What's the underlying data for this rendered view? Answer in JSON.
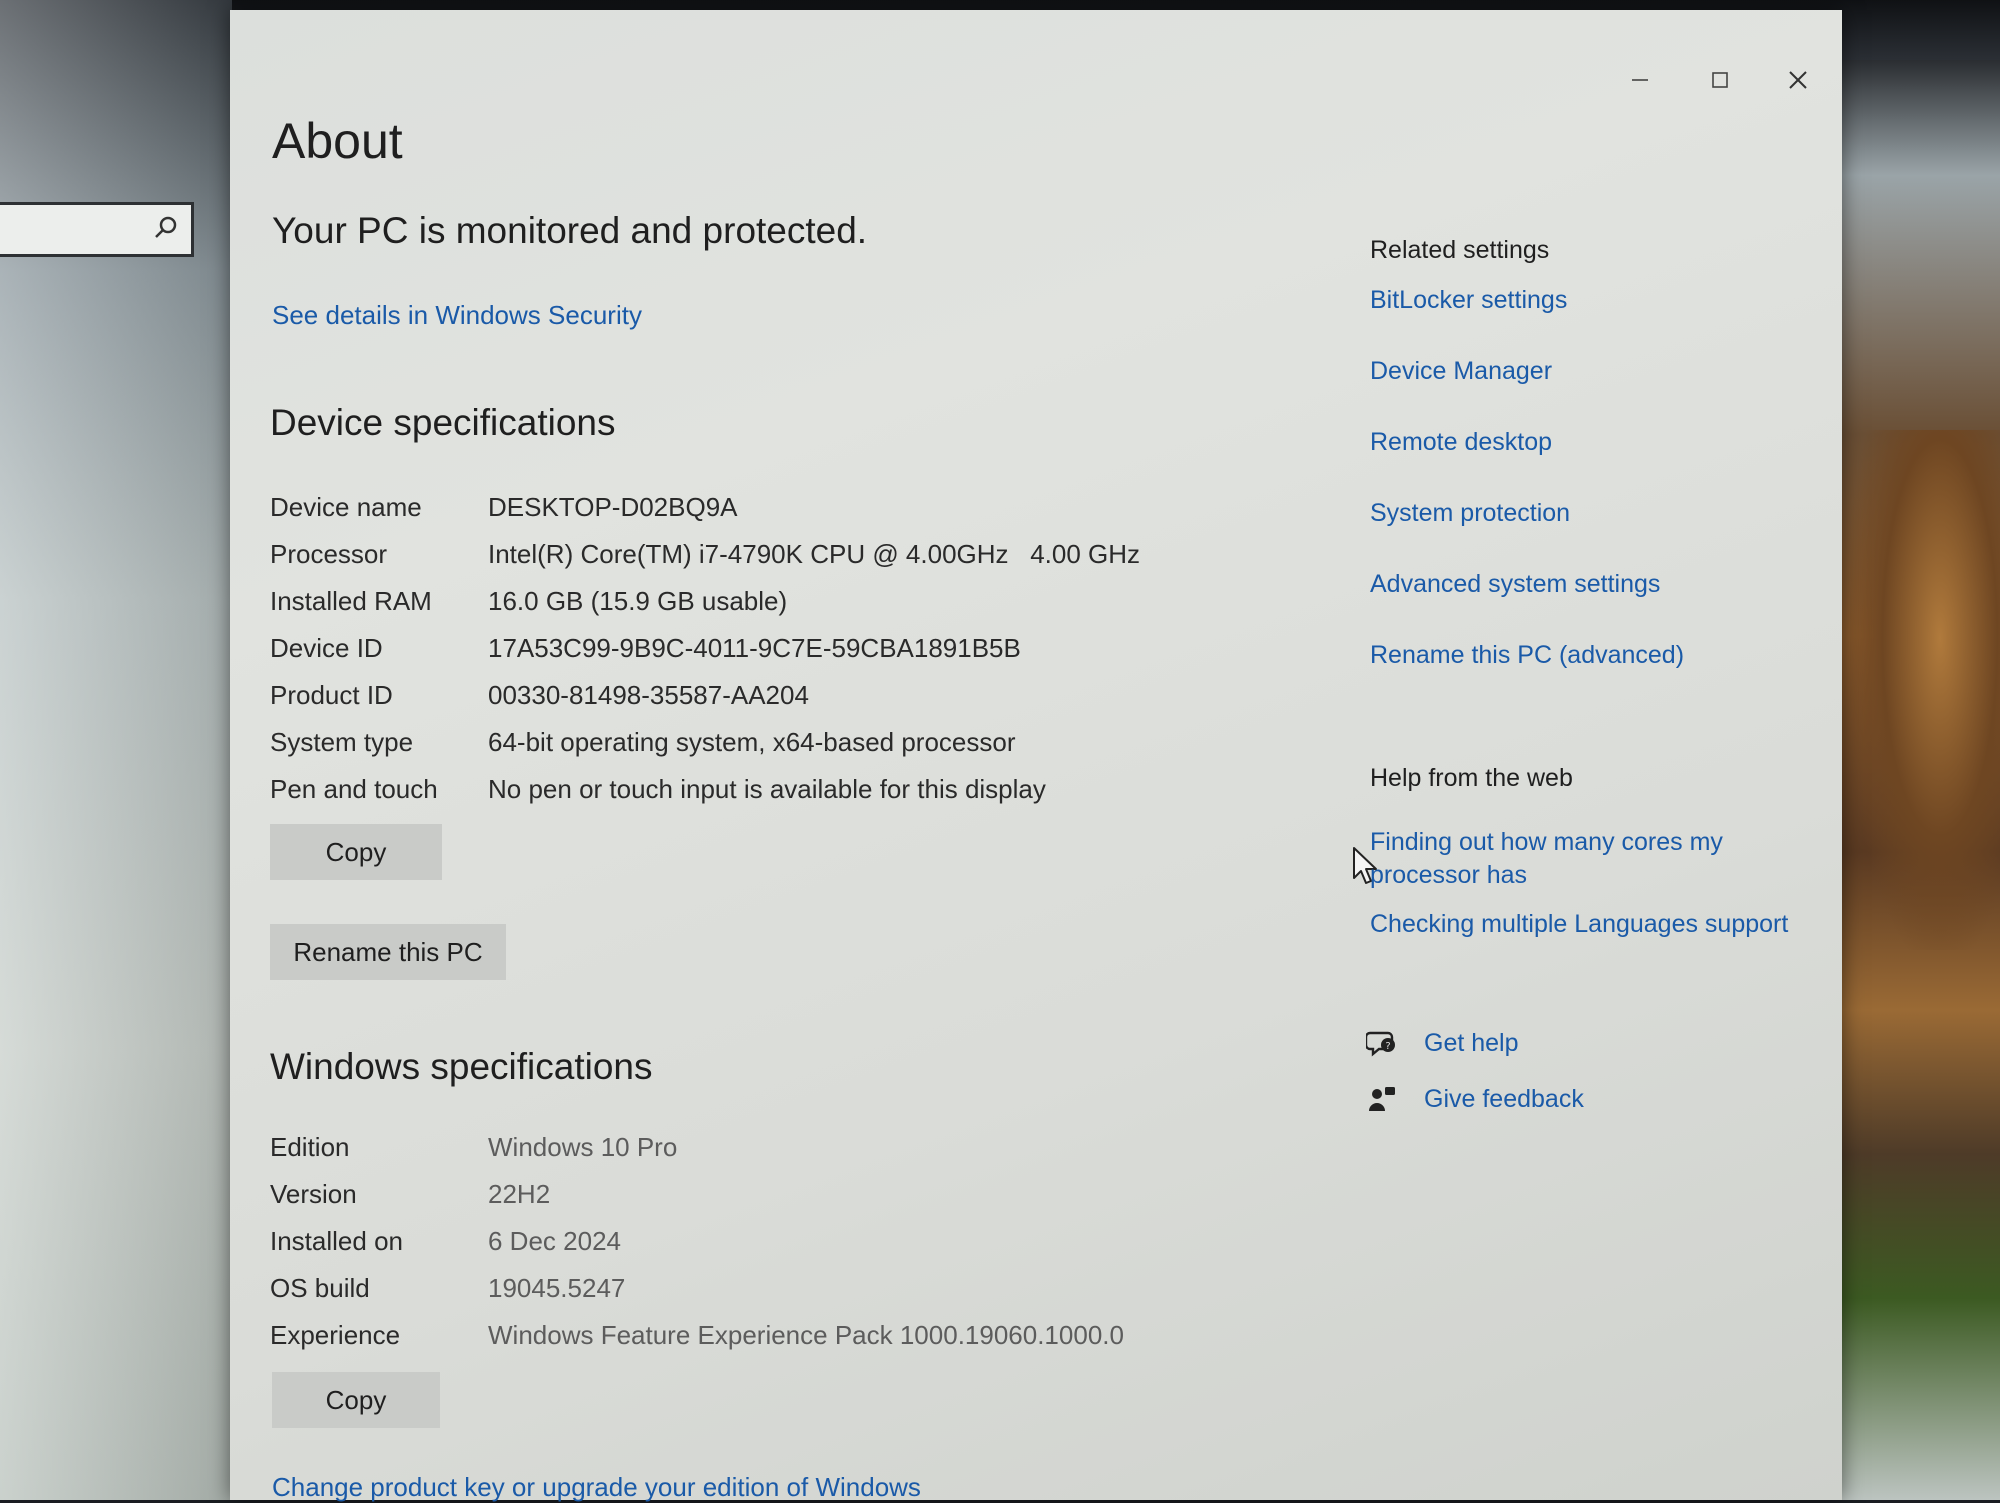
{
  "window": {
    "controls": {
      "minimize": "minimize",
      "maximize": "maximize",
      "close": "close"
    }
  },
  "page": {
    "title": "About",
    "protection_status": "Your PC is monitored and protected.",
    "security_link": "See details in Windows Security"
  },
  "device_specs": {
    "heading": "Device specifications",
    "rows": [
      {
        "label": "Device name",
        "value": "DESKTOP-D02BQ9A"
      },
      {
        "label": "Processor",
        "value": "Intel(R) Core(TM) i7-4790K CPU @ 4.00GHz   4.00 GHz"
      },
      {
        "label": "Installed RAM",
        "value": "16.0 GB (15.9 GB usable)"
      },
      {
        "label": "Device ID",
        "value": "17A53C99-9B9C-4011-9C7E-59CBA1891B5B"
      },
      {
        "label": "Product ID",
        "value": "00330-81498-35587-AA204"
      },
      {
        "label": "System type",
        "value": "64-bit operating system, x64-based processor"
      },
      {
        "label": "Pen and touch",
        "value": "No pen or touch input is available for this display"
      }
    ],
    "copy_button": "Copy",
    "rename_button": "Rename this PC"
  },
  "windows_specs": {
    "heading": "Windows specifications",
    "rows": [
      {
        "label": "Edition",
        "value": "Windows 10 Pro"
      },
      {
        "label": "Version",
        "value": "22H2"
      },
      {
        "label": "Installed on",
        "value": "6 Dec 2024"
      },
      {
        "label": "OS build",
        "value": "19045.5247"
      },
      {
        "label": "Experience",
        "value": "Windows Feature Experience Pack 1000.19060.1000.0"
      }
    ],
    "copy_button": "Copy",
    "product_key_link": "Change product key or upgrade your edition of Windows"
  },
  "related_settings": {
    "heading": "Related settings",
    "links": [
      "BitLocker settings",
      "Device Manager",
      "Remote desktop",
      "System protection",
      "Advanced system settings",
      "Rename this PC (advanced)"
    ]
  },
  "help_from_web": {
    "heading": "Help from the web",
    "links": [
      "Finding out how many cores my processor has",
      "Checking multiple Languages support"
    ]
  },
  "support": {
    "get_help": {
      "label": "Get help",
      "icon": "get-help-icon"
    },
    "give_feedback": {
      "label": "Give feedback",
      "icon": "feedback-icon"
    }
  },
  "colors": {
    "link": "#1a5aa8",
    "window_bg": "#dcdfdc",
    "button_bg": "#c9cbc8"
  }
}
